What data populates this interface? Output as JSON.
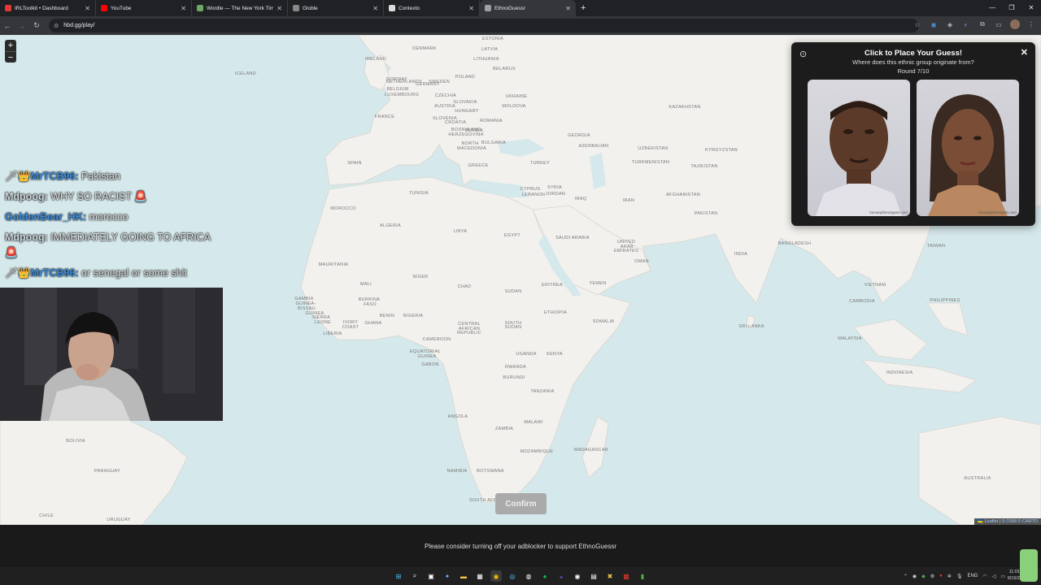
{
  "browser": {
    "tabs": [
      {
        "label": "IRLToolkit • Dashboard",
        "color": "#e53935"
      },
      {
        "label": "YouTube",
        "color": "#ff0000"
      },
      {
        "label": "Wordle — The New York Times",
        "color": "#6aaa64"
      },
      {
        "label": "Globle",
        "color": "#888888"
      },
      {
        "label": "Contexto",
        "color": "#dddddd"
      },
      {
        "label": "EthnoGuessr",
        "color": "#9aa0a6"
      }
    ],
    "url": "hbd.gg/play/"
  },
  "map": {
    "labels": [
      [
        "ICELAND",
        302,
        48
      ],
      [
        "NORWAY",
        488,
        55
      ],
      [
        "SWEDEN",
        540,
        58
      ],
      [
        "ESTONIA",
        606,
        5
      ],
      [
        "LATVIA",
        602,
        18
      ],
      [
        "DENMARK",
        522,
        17
      ],
      [
        "LITHUANIA",
        598,
        30
      ],
      [
        "BELARUS",
        620,
        42
      ],
      [
        "POLAND",
        572,
        52
      ],
      [
        "IRELAND",
        462,
        30
      ],
      [
        "NETHERLANDS",
        497,
        58
      ],
      [
        "BELGIUM",
        489,
        67
      ],
      [
        "GERMANY",
        526,
        61
      ],
      [
        "LUXEMBOURG",
        494,
        74
      ],
      [
        "CZECHIA",
        548,
        75
      ],
      [
        "UKRAINE",
        635,
        76
      ],
      [
        "SLOVAKIA",
        572,
        83
      ],
      [
        "MOLDOVA",
        632,
        88
      ],
      [
        "AUSTRIA",
        547,
        88
      ],
      [
        "HUNGARY",
        574,
        94
      ],
      [
        "SLOVENIA",
        547,
        103
      ],
      [
        "CROATIA",
        560,
        108
      ],
      [
        "ROMANIA",
        604,
        106
      ],
      [
        "FRANCE",
        473,
        101
      ],
      [
        "BOSNIA AND",
        573,
        117
      ],
      [
        "HERZEGOVINA",
        573,
        123
      ],
      [
        "SERBIA",
        583,
        118
      ],
      [
        "NORTH",
        578,
        134
      ],
      [
        "MACEDONIA",
        580,
        140
      ],
      [
        "BULGARIA",
        607,
        133
      ],
      [
        "SPAIN",
        436,
        158
      ],
      [
        "GREECE",
        588,
        161
      ],
      [
        "TURKEY",
        664,
        158
      ],
      [
        "GEORGIA",
        712,
        124
      ],
      [
        "AZERBAIJAN",
        730,
        137
      ],
      [
        "KAZAKHSTAN",
        842,
        89
      ],
      [
        "UZBEKISTAN",
        803,
        140
      ],
      [
        "KYRGYZSTAN",
        887,
        142
      ],
      [
        "TURKMENISTAN",
        800,
        157
      ],
      [
        "TAJIKISTAN",
        866,
        162
      ],
      [
        "SYRIA",
        682,
        188
      ],
      [
        "CYPRUS",
        652,
        190
      ],
      [
        "LEBANON",
        656,
        197
      ],
      [
        "JORDAN",
        683,
        196
      ],
      [
        "IRAQ",
        714,
        202
      ],
      [
        "IRAN",
        773,
        204
      ],
      [
        "AFGHANISTAN",
        840,
        197
      ],
      [
        "PAKISTAN",
        868,
        220
      ],
      [
        "TUNISIA",
        515,
        195
      ],
      [
        "MOROCCO",
        422,
        214
      ],
      [
        "ALGERIA",
        480,
        235
      ],
      [
        "LIBYA",
        566,
        242
      ],
      [
        "EGYPT",
        630,
        247
      ],
      [
        "SAUDI ARABIA",
        704,
        250
      ],
      [
        "UNITED",
        770,
        255
      ],
      [
        "ARAB",
        771,
        261
      ],
      [
        "EMIRATES",
        770,
        266
      ],
      [
        "OMAN",
        789,
        279
      ],
      [
        "BANGLADESH",
        977,
        257
      ],
      [
        "INDIA",
        911,
        270
      ],
      [
        "TAIWAN",
        1151,
        260
      ],
      [
        "MAURITANIA",
        410,
        283
      ],
      [
        "MALI",
        450,
        307
      ],
      [
        "NIGER",
        517,
        298
      ],
      [
        "CHAD",
        571,
        310
      ],
      [
        "SUDAN",
        631,
        316
      ],
      [
        "ERITREA",
        679,
        308
      ],
      [
        "YEMEN",
        735,
        306
      ],
      [
        "VIETNAM",
        1076,
        308
      ],
      [
        "PHILIPPINES",
        1162,
        327
      ],
      [
        "GAMBIA",
        374,
        325
      ],
      [
        "GUINEA-",
        376,
        331
      ],
      [
        "BISSAU",
        377,
        337
      ],
      [
        "GUINEA",
        387,
        343
      ],
      [
        "BURKINA",
        454,
        326
      ],
      [
        "FASO",
        455,
        332
      ],
      [
        "BENIN",
        476,
        346
      ],
      [
        "NIGERIA",
        508,
        346
      ],
      [
        "CAMBODIA",
        1060,
        328
      ],
      [
        "ETHIOPIA",
        683,
        342
      ],
      [
        "SIERRA",
        395,
        348
      ],
      [
        "LEONE",
        397,
        354
      ],
      [
        "IVORY",
        431,
        354
      ],
      [
        "COAST",
        431,
        360
      ],
      [
        "GHANA",
        459,
        355
      ],
      [
        "CENTRAL",
        577,
        356
      ],
      [
        "AFRICAN",
        577,
        362
      ],
      [
        "REPUBLIC",
        577,
        367
      ],
      [
        "SOUTH",
        631,
        355
      ],
      [
        "SUDAN",
        631,
        360
      ],
      [
        "SOMALIA",
        742,
        353
      ],
      [
        "LIBERIA",
        409,
        368
      ],
      [
        "SRI LANKA",
        924,
        359
      ],
      [
        "CAMEROON",
        537,
        375
      ],
      [
        "MALAYSIA",
        1045,
        374
      ],
      [
        "EQUATORIAL",
        523,
        390
      ],
      [
        "GUINEA",
        525,
        396
      ],
      [
        "UGANDA",
        647,
        393
      ],
      [
        "KENYA",
        682,
        393
      ],
      [
        "GABON",
        529,
        406
      ],
      [
        "RWANDA",
        634,
        409
      ],
      [
        "BURUNDI",
        632,
        422
      ],
      [
        "INDONESIA",
        1106,
        416
      ],
      [
        "TANZANIA",
        667,
        439
      ],
      [
        "ANGOLA",
        563,
        470
      ],
      [
        "MALAWI",
        656,
        477
      ],
      [
        "ZAMBIA",
        620,
        485
      ],
      [
        "BOLIVIA",
        93,
        500
      ],
      [
        "MOZAMBIQUE",
        660,
        513
      ],
      [
        "MADAGASCAR",
        727,
        511
      ],
      [
        "PARAGUAY",
        132,
        537
      ],
      [
        "NAMIBIA",
        562,
        537
      ],
      [
        "BOTSWANA",
        603,
        537
      ],
      [
        "AUSTRALIA",
        1202,
        546
      ],
      [
        "SOUTH AFRICA",
        599,
        573
      ],
      [
        "CHILE",
        57,
        592
      ],
      [
        "URUGUAY",
        146,
        597
      ]
    ],
    "zoom_in": "+",
    "zoom_out": "−",
    "attribution": "🇺🇦 Leaflet | © OSM © CARTO",
    "confirm_label": "Confirm"
  },
  "panel": {
    "title": "Click to Place Your Guess!",
    "subtitle": "Where does this ethnic group originate from?",
    "round": "Round 7/10",
    "watermark_left": "humanphenotypes.com",
    "watermark_right": "humanphenotypes.com"
  },
  "chat": [
    {
      "prefix": "🗡👑",
      "user": "MrTCB96",
      "color": "#3a8de0",
      "text": "Pakistan"
    },
    {
      "prefix": "",
      "user": "Mdpoog",
      "color": "#cfd8dc",
      "text": "WHY SO RACIST 🚨"
    },
    {
      "prefix": "",
      "user": "GoldenBear_HK",
      "color": "#3a8de0",
      "text": "morocco"
    },
    {
      "prefix": "",
      "user": "Mdpoog",
      "color": "#cfd8dc",
      "text": "IMMEDIATELY GOING TO AFRICA 🚨"
    },
    {
      "prefix": "🗡👑",
      "user": "MrTCB96",
      "color": "#3a8de0",
      "text": "or senegal or some shit"
    }
  ],
  "footer": {
    "text": "Please consider turning off your adblocker to support EthnoGuessr"
  },
  "tray": {
    "lang": "ENG",
    "time": "11:01",
    "date": "9/15/2"
  }
}
